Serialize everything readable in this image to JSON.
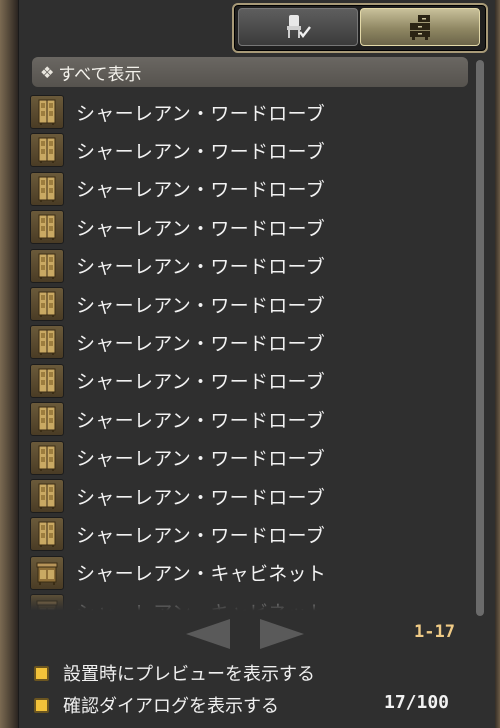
{
  "tabs": [
    {
      "name": "furnishing-tab",
      "icon": "chair-check-icon",
      "active": false
    },
    {
      "name": "storage-tab",
      "icon": "dresser-icon",
      "active": true
    }
  ],
  "category": {
    "label": "すべて表示",
    "icon": "diamond-icon"
  },
  "items": [
    {
      "label": "シャーレアン・ワードローブ",
      "icon": "wardrobe-icon"
    },
    {
      "label": "シャーレアン・ワードローブ",
      "icon": "wardrobe-icon"
    },
    {
      "label": "シャーレアン・ワードローブ",
      "icon": "wardrobe-icon"
    },
    {
      "label": "シャーレアン・ワードローブ",
      "icon": "wardrobe-icon"
    },
    {
      "label": "シャーレアン・ワードローブ",
      "icon": "wardrobe-icon"
    },
    {
      "label": "シャーレアン・ワードローブ",
      "icon": "wardrobe-icon"
    },
    {
      "label": "シャーレアン・ワードローブ",
      "icon": "wardrobe-icon"
    },
    {
      "label": "シャーレアン・ワードローブ",
      "icon": "wardrobe-icon"
    },
    {
      "label": "シャーレアン・ワードローブ",
      "icon": "wardrobe-icon"
    },
    {
      "label": "シャーレアン・ワードローブ",
      "icon": "wardrobe-icon"
    },
    {
      "label": "シャーレアン・ワードローブ",
      "icon": "wardrobe-icon"
    },
    {
      "label": "シャーレアン・ワードローブ",
      "icon": "wardrobe-icon"
    },
    {
      "label": "シャーレアン・キャビネット",
      "icon": "cabinet-icon"
    },
    {
      "label": "シャーレアン・キャビネット",
      "icon": "cabinet-icon"
    }
  ],
  "pager": {
    "range": "1-17",
    "prev_icon": "arrow-left-icon",
    "next_icon": "arrow-right-icon"
  },
  "options": [
    {
      "label": "設置時にプレビューを表示する",
      "checked": true
    },
    {
      "label": "確認ダイアログを表示する",
      "checked": true
    }
  ],
  "count": "17/100",
  "colors": {
    "accent_gold": "#f0cb86",
    "checkbox": "#f2c23a"
  }
}
